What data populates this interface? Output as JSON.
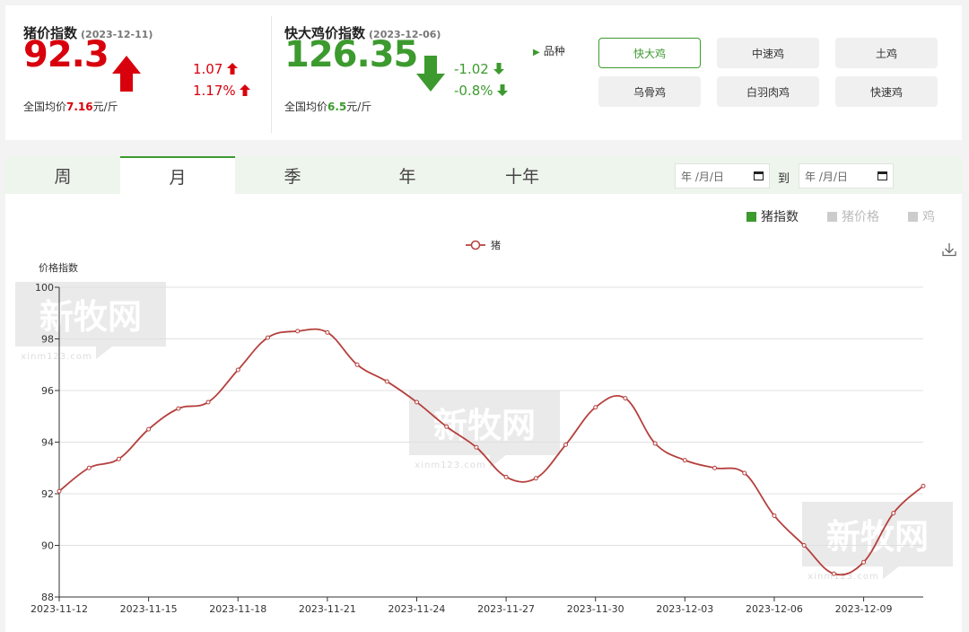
{
  "pig": {
    "title": "猪价指数",
    "date": "(2023-12-11)",
    "value": "92.3",
    "change_abs": "1.07",
    "change_pct": "1.17%",
    "avg_prefix": "全国均价",
    "avg_value": "7.16",
    "avg_unit": "元/斤"
  },
  "chicken": {
    "title": "快大鸡价指数",
    "date": "(2023-12-06)",
    "value": "126.35",
    "change_abs": "-1.02",
    "change_pct": "-0.8%",
    "avg_prefix": "全国均价",
    "avg_value": "6.5",
    "avg_unit": "元/斤"
  },
  "variety": {
    "label": "品种",
    "options": [
      "快大鸡",
      "中速鸡",
      "土鸡",
      "乌骨鸡",
      "白羽肉鸡",
      "快速鸡"
    ],
    "selected": "快大鸡"
  },
  "tabs": [
    "周",
    "月",
    "季",
    "年",
    "十年"
  ],
  "active_tab": "月",
  "date_range": {
    "start_placeholder": "年 /月/日",
    "end_placeholder": "年 /月/日",
    "separator": "到"
  },
  "toggles": [
    {
      "label": "猪指数",
      "active": true
    },
    {
      "label": "猪价格",
      "active": false
    },
    {
      "label": "鸡",
      "active": false
    }
  ],
  "watermark": {
    "text": "新牧网",
    "sub": "xinm123.com"
  },
  "colors": {
    "up": "#d8000c",
    "down": "#3c9a2e",
    "accent": "#3c9a2e",
    "line": "#b5403d"
  },
  "icons": {
    "up": "arrow-up-icon",
    "down": "arrow-down-icon",
    "download": "download-icon",
    "calendar": "calendar-icon"
  },
  "chart_data": {
    "type": "line",
    "title": "",
    "ylabel": "价格指数",
    "xlabel": "",
    "ylim": [
      88,
      100
    ],
    "yticks": [
      88,
      90,
      92,
      94,
      96,
      98,
      100
    ],
    "legend": "top-center",
    "grid": true,
    "x": [
      "2023-11-12",
      "2023-11-13",
      "2023-11-14",
      "2023-11-15",
      "2023-11-16",
      "2023-11-17",
      "2023-11-18",
      "2023-11-19",
      "2023-11-20",
      "2023-11-21",
      "2023-11-22",
      "2023-11-23",
      "2023-11-24",
      "2023-11-25",
      "2023-11-26",
      "2023-11-27",
      "2023-11-28",
      "2023-11-29",
      "2023-11-30",
      "2023-12-01",
      "2023-12-02",
      "2023-12-03",
      "2023-12-04",
      "2023-12-05",
      "2023-12-06",
      "2023-12-07",
      "2023-12-08",
      "2023-12-09",
      "2023-12-10",
      "2023-12-11"
    ],
    "xtick_labels": [
      "2023-11-12",
      "2023-11-15",
      "2023-11-18",
      "2023-11-21",
      "2023-11-24",
      "2023-11-27",
      "2023-11-30",
      "2023-12-03",
      "2023-12-06",
      "2023-12-09"
    ],
    "series": [
      {
        "name": "猪",
        "values": [
          92.1,
          93.0,
          93.35,
          94.5,
          95.3,
          95.55,
          96.8,
          98.05,
          98.3,
          98.25,
          97.0,
          96.35,
          95.55,
          94.6,
          93.8,
          92.65,
          92.6,
          93.9,
          95.35,
          95.7,
          93.95,
          93.3,
          93.0,
          92.8,
          91.15,
          90.0,
          88.9,
          89.35,
          91.25,
          92.3
        ]
      }
    ]
  }
}
